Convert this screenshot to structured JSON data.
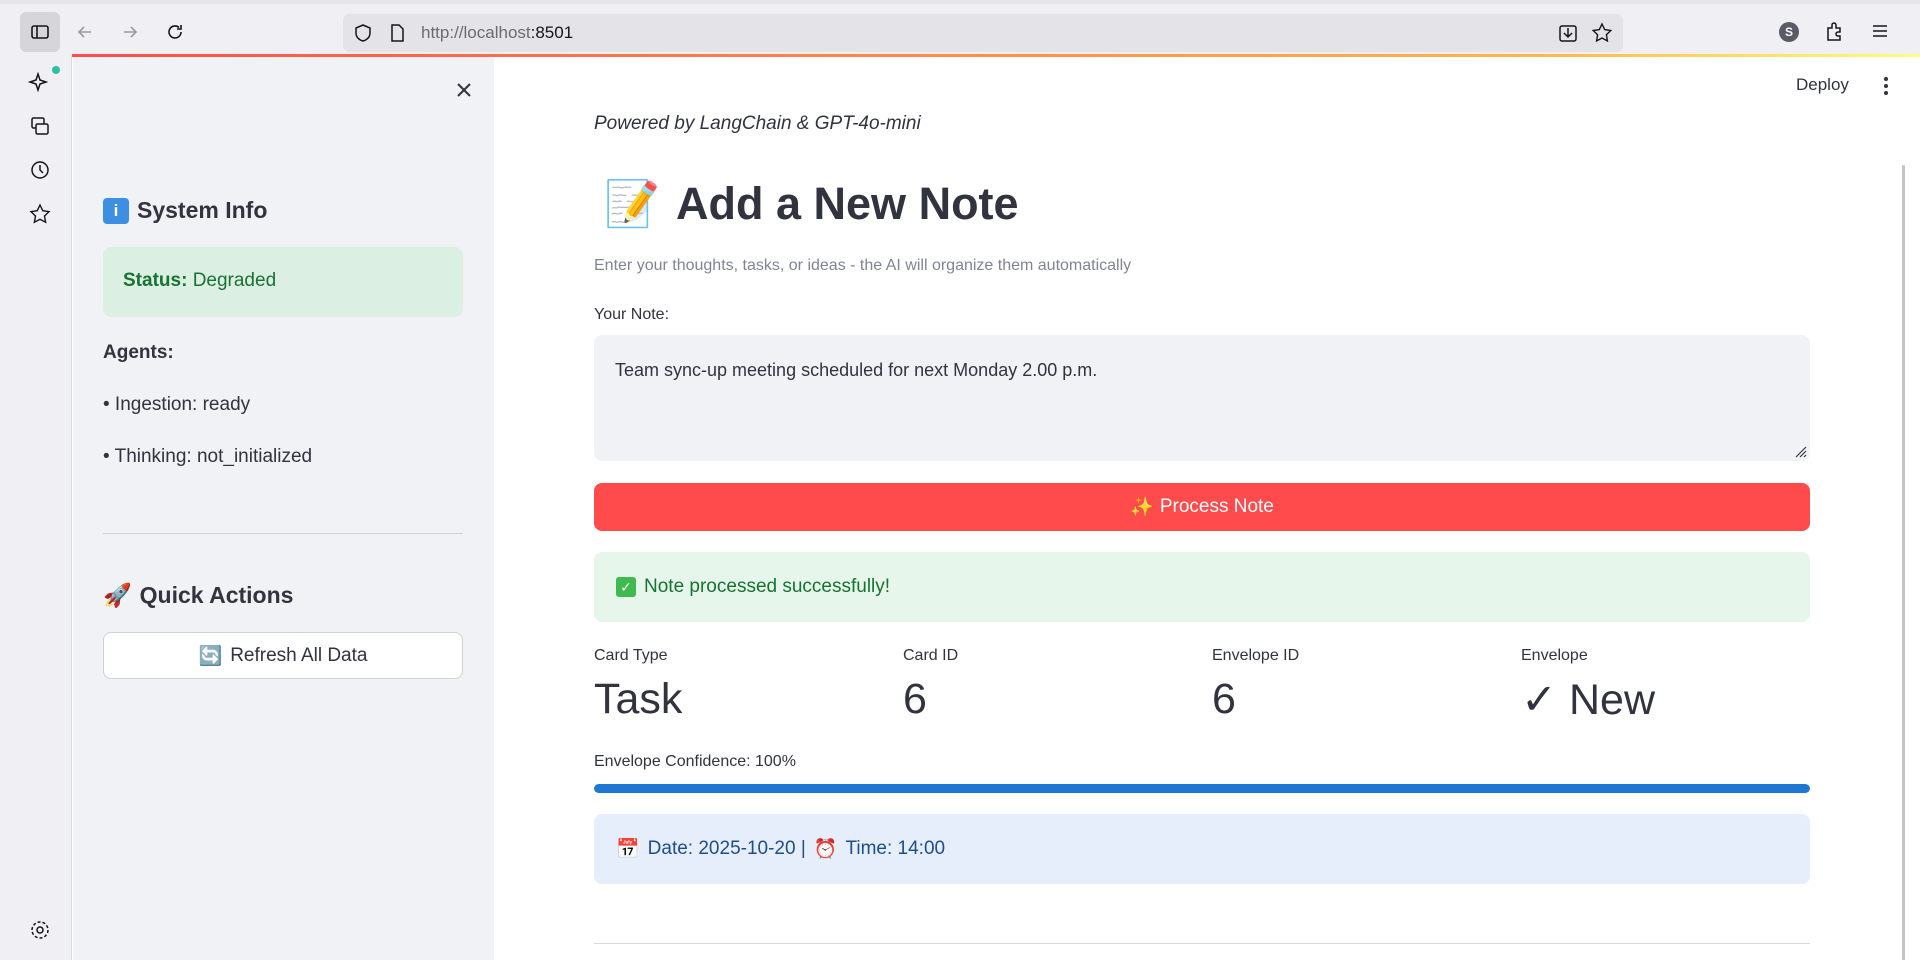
{
  "browser": {
    "url_host": "http://localhost",
    "url_port": ":8501",
    "account_initial": "S"
  },
  "header": {
    "deploy_label": "Deploy"
  },
  "sidebar": {
    "system_info_icon": "i",
    "system_info_title": "System Info",
    "status_label": "Status:",
    "status_value": "Degraded",
    "agents_title": "Agents:",
    "agent_ingestion": "• Ingestion: ready",
    "agent_thinking": "• Thinking: not_initialized",
    "quick_actions_icon": "🚀",
    "quick_actions_title": "Quick Actions",
    "refresh_icon": "🔄",
    "refresh_label": "Refresh All Data"
  },
  "main": {
    "powered_by": "Powered by LangChain & GPT-4o-mini",
    "title_icon": "📝",
    "title": "Add a New Note",
    "subtitle": "Enter your thoughts, tasks, or ideas - the AI will organize them automatically",
    "note_label": "Your Note:",
    "note_value": "Team sync-up meeting scheduled for next Monday 2.00 p.m.",
    "process_icon": "✨",
    "process_label": "Process Note",
    "success_icon": "✓",
    "success_message": "Note processed successfully!",
    "metrics": [
      {
        "label": "Card Type",
        "value": "Task"
      },
      {
        "label": "Card ID",
        "value": "6"
      },
      {
        "label": "Envelope ID",
        "value": "6"
      },
      {
        "label": "Envelope",
        "value": "✓ New"
      }
    ],
    "confidence_label": "Envelope Confidence: 100%",
    "confidence_value": 1.0,
    "date_icon": "📅",
    "date_text": "Date: 2025-10-20 |",
    "time_icon": "⏰",
    "time_text": "Time: 14:00"
  },
  "colors": {
    "primary": "#ff4b4b",
    "success_bg": "#e6f6ea",
    "info_bg": "#e5eefa",
    "progress": "#1f77d4"
  },
  "icons": [
    "sidebar-toggle-icon",
    "back-arrow-icon",
    "forward-arrow-icon",
    "reload-icon",
    "shield-icon",
    "page-icon",
    "save-to-pocket-icon",
    "bookmark-star-icon",
    "account-icon",
    "extensions-icon",
    "hamburger-menu-icon",
    "ai-sparkle-icon",
    "synced-tabs-icon",
    "history-icon",
    "bookmarks-star-icon",
    "settings-gear-icon",
    "close-icon",
    "kebab-menu-icon"
  ]
}
